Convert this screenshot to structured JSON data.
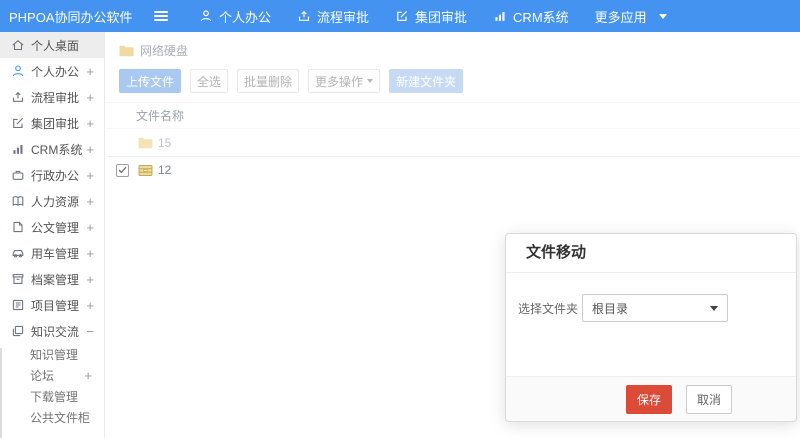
{
  "topbar": {
    "logo": "PHPOA协同办公软件",
    "nav": [
      {
        "label": "个人办公",
        "icon": "user-icon"
      },
      {
        "label": "流程审批",
        "icon": "upload-icon"
      },
      {
        "label": "集团审批",
        "icon": "edit-icon"
      },
      {
        "label": "CRM系统",
        "icon": "chart-icon"
      },
      {
        "label": "更多应用",
        "icon": "caret-down-icon"
      }
    ]
  },
  "sidebar": {
    "items": [
      {
        "label": "个人桌面",
        "expand": "",
        "icon": "home-icon"
      },
      {
        "label": "个人办公",
        "expand": "+",
        "icon": "user-icon"
      },
      {
        "label": "流程审批",
        "expand": "+",
        "icon": "upload-icon"
      },
      {
        "label": "集团审批",
        "expand": "+",
        "icon": "edit-icon"
      },
      {
        "label": "CRM系统",
        "expand": "+",
        "icon": "chart-icon"
      },
      {
        "label": "行政办公",
        "expand": "+",
        "icon": "briefcase-icon"
      },
      {
        "label": "人力资源",
        "expand": "+",
        "icon": "book-icon"
      },
      {
        "label": "公文管理",
        "expand": "+",
        "icon": "document-icon"
      },
      {
        "label": "用车管理",
        "expand": "+",
        "icon": "car-icon"
      },
      {
        "label": "档案管理",
        "expand": "+",
        "icon": "archive-icon"
      },
      {
        "label": "项目管理",
        "expand": "+",
        "icon": "list-icon"
      },
      {
        "label": "知识交流",
        "expand": "−",
        "icon": "layers-icon"
      }
    ],
    "subitems": [
      {
        "label": "知识管理",
        "expand": ""
      },
      {
        "label": "论坛",
        "expand": "+"
      },
      {
        "label": "下载管理",
        "expand": ""
      },
      {
        "label": "公共文件柜",
        "expand": ""
      }
    ]
  },
  "content": {
    "breadcrumb": "网络硬盘",
    "toolbar": {
      "upload": "上传文件",
      "select_all": "全选",
      "batch_delete": "批量删除",
      "more_actions": "更多操作",
      "new_folder": "新建文件夹"
    },
    "table": {
      "name_header": "文件名称",
      "rows": [
        {
          "name": "15",
          "type": "folder",
          "checked": false
        },
        {
          "name": "12",
          "type": "archive-file",
          "checked": true
        }
      ]
    }
  },
  "modal": {
    "title": "文件移动",
    "field_label": "选择文件夹",
    "select_value": "根目录",
    "save_label": "保存",
    "cancel_label": "取消"
  },
  "colors": {
    "topbar_blue": "#4493f0",
    "save_red": "#dc4a38",
    "folder_yellow": "#f0d58f"
  }
}
